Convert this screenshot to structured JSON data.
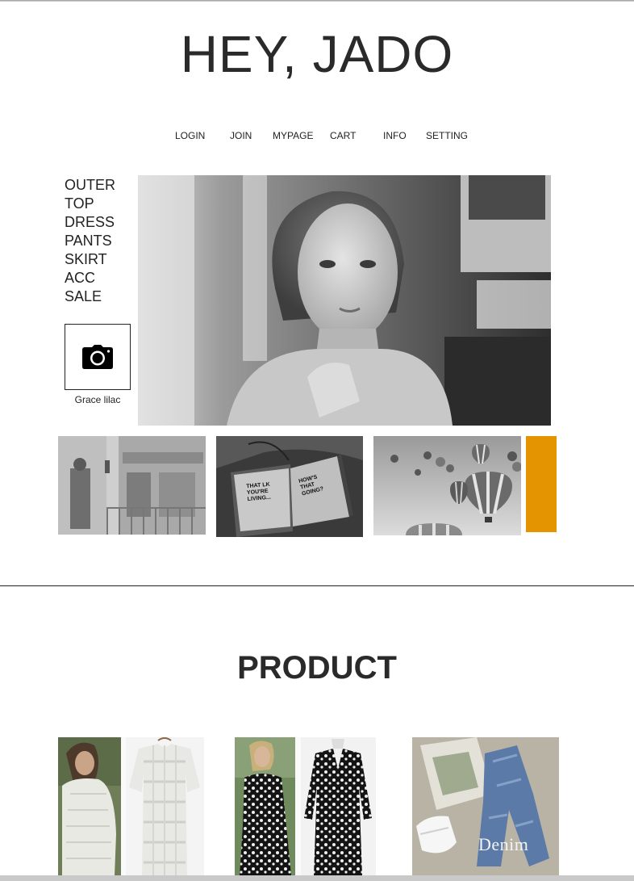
{
  "site": {
    "title": "HEY, JADO"
  },
  "topnav": {
    "items": [
      {
        "label": "LOGIN"
      },
      {
        "label": "JOIN"
      },
      {
        "label": "MYPAGE"
      },
      {
        "label": "CART"
      },
      {
        "label": "INFO"
      },
      {
        "label": "SETTING"
      }
    ]
  },
  "categories": {
    "items": [
      {
        "label": "OUTER"
      },
      {
        "label": "TOP"
      },
      {
        "label": "DRESS"
      },
      {
        "label": "PANTS"
      },
      {
        "label": "SKIRT"
      },
      {
        "label": "ACC"
      },
      {
        "label": "SALE"
      }
    ]
  },
  "profile": {
    "icon": "camera-icon",
    "name": "Grace lilac"
  },
  "thumbnails": {
    "notebook_text_left": "THAT LK YOU'RE LIVING...",
    "notebook_text_right": "HOW'S THAT GOING?"
  },
  "colors": {
    "accent": "#E39400",
    "text": "#2b2b2b"
  },
  "products_section": {
    "title": "PRODUCT",
    "items": [
      {
        "image": "white-lace-dress"
      },
      {
        "image": "black-print-dress"
      },
      {
        "image": "denim-jeans",
        "caption": "Denim"
      }
    ]
  }
}
